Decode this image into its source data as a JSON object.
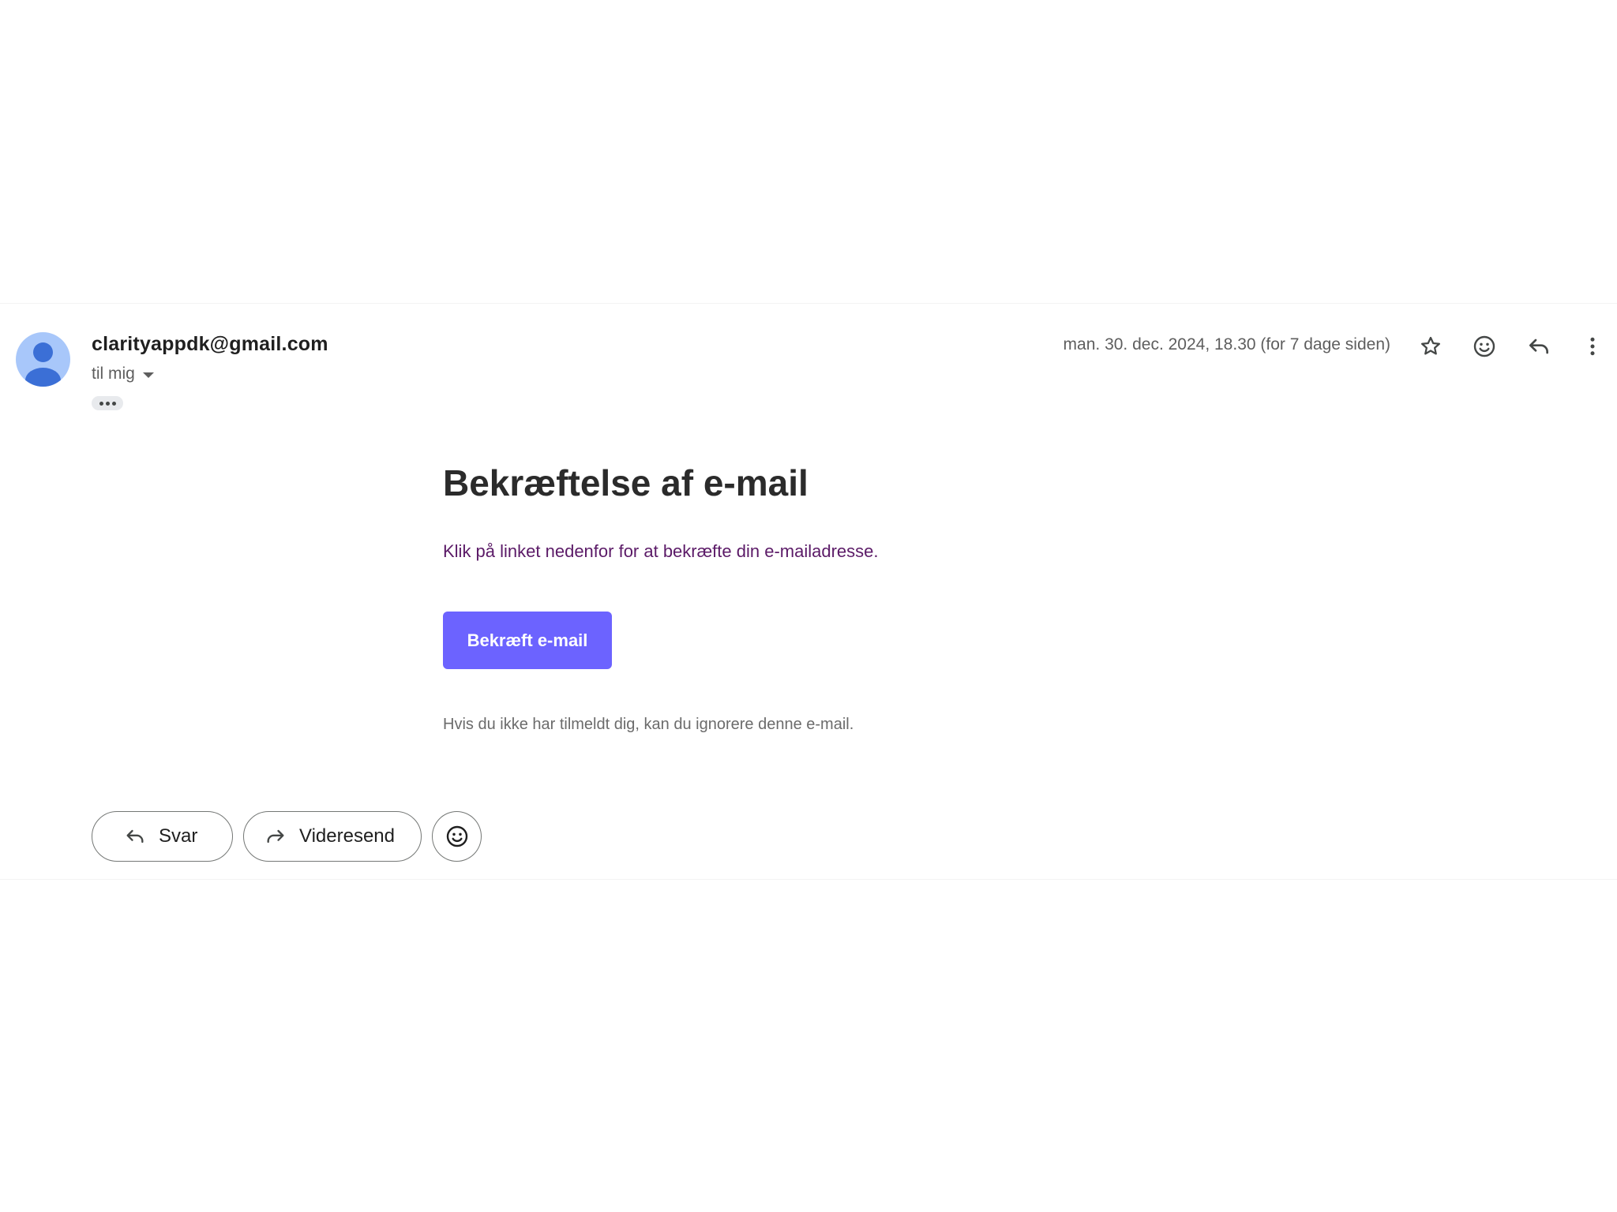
{
  "sender": {
    "email": "clarityappdk@gmail.com",
    "recipient_label": "til mig",
    "timestamp": "man. 30. dec. 2024, 18.30 (for 7 dage siden)"
  },
  "header_actions": {
    "star_icon": "star-icon",
    "emoji_icon": "smiley-icon",
    "reply_icon": "reply-icon",
    "more_icon": "more-vertical-icon"
  },
  "email_body": {
    "heading": "Bekræftelse af e-mail",
    "instruction": "Klik på linket nedenfor for at bekræfte din e-mailadresse.",
    "confirm_button_label": "Bekræft e-mail",
    "footer_note": "Hvis du ikke har tilmeldt dig, kan du ignorere denne e-mail."
  },
  "actions": {
    "reply_label": "Svar",
    "forward_label": "Videresend"
  },
  "colors": {
    "avatar_bg": "#a8c7fa",
    "avatar_fg": "#3b6fd6",
    "confirm_button_bg": "#6c63ff",
    "instruction_text": "#5b1a67"
  }
}
